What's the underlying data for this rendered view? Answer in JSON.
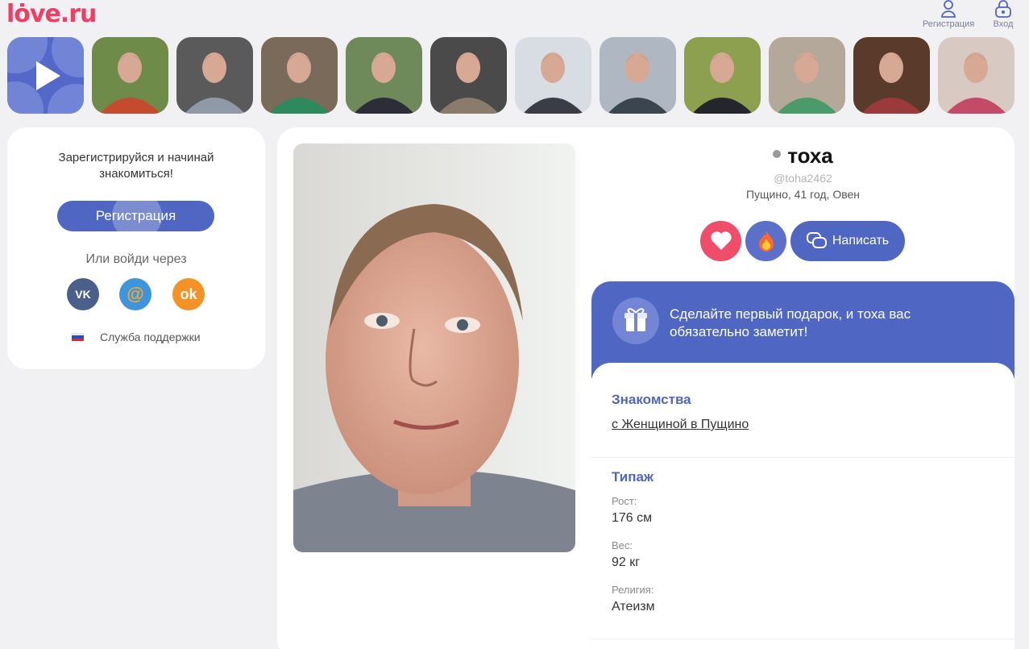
{
  "brand": {
    "logo": "lȯve.ru",
    "accent": "#ef3d63",
    "primary": "#4f66c2"
  },
  "header": {
    "register_label": "Регистрация",
    "login_label": "Вход"
  },
  "stories": {
    "play_icon": "play-icon",
    "avatars": [
      {
        "bg1": "#6e8b4a",
        "bg2": "#c44b2f",
        "name": "user-avatar-1"
      },
      {
        "bg1": "#5a5a5a",
        "bg2": "#8f9aa6",
        "name": "user-avatar-2"
      },
      {
        "bg1": "#7a6a5a",
        "bg2": "#2e8a5c",
        "name": "user-avatar-3"
      },
      {
        "bg1": "#6f8a5a",
        "bg2": "#2d2d3a",
        "name": "user-avatar-4"
      },
      {
        "bg1": "#4a4a4a",
        "bg2": "#8a7b6a",
        "name": "user-avatar-5"
      },
      {
        "bg1": "#d8dde4",
        "bg2": "#3a3d45",
        "name": "user-avatar-6"
      },
      {
        "bg1": "#aeb7c2",
        "bg2": "#3b4550",
        "name": "user-avatar-7"
      },
      {
        "bg1": "#8ca050",
        "bg2": "#24262b",
        "name": "user-avatar-8"
      },
      {
        "bg1": "#b3a89a",
        "bg2": "#4a9a6a",
        "name": "user-avatar-9"
      },
      {
        "bg1": "#5a3a2a",
        "bg2": "#9a3a3a",
        "name": "user-avatar-10"
      },
      {
        "bg1": "#d8c9c2",
        "bg2": "#c44a6a",
        "name": "user-avatar-11"
      }
    ]
  },
  "left": {
    "intro": "Зарегистрируйся и начинай знакомиться!",
    "register_button": "Регистрация",
    "or_text": "Или войди через",
    "social": {
      "vk": "VK",
      "mail": "@",
      "ok": "ok"
    },
    "support": "Служба поддержки"
  },
  "profile": {
    "name": "тоха",
    "handle": "@toha2462",
    "meta": "Пущино, 41 год, Овен",
    "write_button": "Написать",
    "gift_text": "Сделайте первый подарок, и тоха вас обязательно заметит!"
  },
  "sections": {
    "dating_title": "Знакомства",
    "dating_link": "с Женщиной в Пущино",
    "type_title": "Типаж",
    "height_label": "Рост:",
    "height_value": "176 см",
    "weight_label": "Вес:",
    "weight_value": "92 кг",
    "religion_label": "Религия:",
    "religion_value": "Атеизм"
  }
}
